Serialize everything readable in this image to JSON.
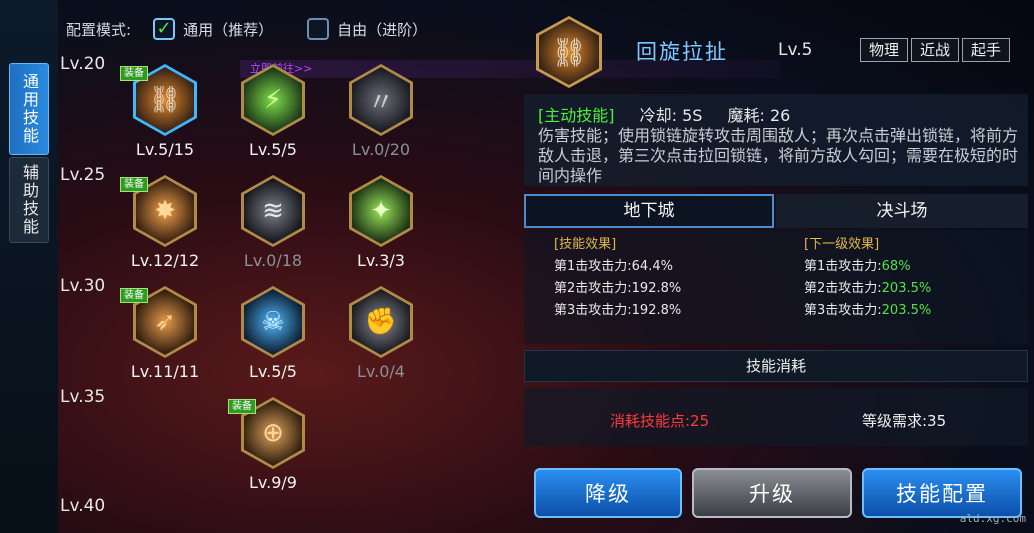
{
  "tabs": [
    {
      "label": "通用技能",
      "active": true
    },
    {
      "label": "辅助技能",
      "active": false
    }
  ],
  "mode": {
    "label": "配置模式:",
    "options": [
      {
        "label": "通用（推荐）",
        "checked": true
      },
      {
        "label": "自由（进阶）",
        "checked": false
      }
    ]
  },
  "go_link": "立即前往>>",
  "levels": [
    "Lv.20",
    "Lv.25",
    "Lv.30",
    "Lv.35",
    "Lv.40"
  ],
  "equip_badge": "装备",
  "skills": [
    {
      "level_text": "Lv.5/15",
      "equipped": true,
      "selected": true,
      "learned": true,
      "icon": "chain-spin-icon"
    },
    {
      "level_text": "Lv.5/5",
      "equipped": false,
      "selected": false,
      "learned": true,
      "icon": "green-slash-icon"
    },
    {
      "level_text": "Lv.0/20",
      "equipped": false,
      "selected": false,
      "learned": false,
      "icon": "claw-slash-icon"
    },
    {
      "level_text": "Lv.12/12",
      "equipped": true,
      "selected": false,
      "learned": true,
      "icon": "spark-burst-icon"
    },
    {
      "level_text": "Lv.0/18",
      "equipped": false,
      "selected": false,
      "learned": false,
      "icon": "wind-slash-icon"
    },
    {
      "level_text": "Lv.3/3",
      "equipped": false,
      "selected": false,
      "learned": true,
      "icon": "green-cannon-icon"
    },
    {
      "level_text": "Lv.11/11",
      "equipped": true,
      "selected": false,
      "learned": true,
      "icon": "fire-arrow-icon"
    },
    {
      "level_text": "Lv.5/5",
      "equipped": false,
      "selected": false,
      "learned": true,
      "icon": "skull-icon"
    },
    {
      "level_text": "Lv.0/4",
      "equipped": false,
      "selected": false,
      "learned": false,
      "icon": "fist-strike-icon"
    },
    {
      "level_text": "Lv.9/9",
      "equipped": true,
      "selected": false,
      "learned": true,
      "icon": "target-throw-icon"
    }
  ],
  "detail": {
    "name": "回旋拉扯",
    "level": "Lv.5",
    "tags": [
      "物理",
      "近战",
      "起手"
    ],
    "type_label": "[主动技能]",
    "cooldown": "冷却: 5S",
    "mana": "魔耗: 26",
    "description": "伤害技能；使用锁链旋转攻击周围敌人；再次点击弹出锁链，将前方敌人击退，第三次点击拉回锁链，将前方敌人勾回；需要在极短的时间内操作"
  },
  "mode_tabs": {
    "dungeon": "地下城",
    "arena": "决斗场"
  },
  "effects": {
    "current_title": "[技能效果]",
    "next_title": "[下一级效果]",
    "rows": [
      {
        "label": "第1击攻击力:",
        "current": "64.4%",
        "next": "68%"
      },
      {
        "label": "第2击攻击力:",
        "current": "192.8%",
        "next": "203.5%"
      },
      {
        "label": "第3击攻击力:",
        "current": "192.8%",
        "next": "203.5%"
      }
    ]
  },
  "cost": {
    "header": "技能消耗",
    "skill_points": "消耗技能点:25",
    "level_req": "等级需求:35"
  },
  "buttons": {
    "downgrade": "降级",
    "upgrade": "升级",
    "config": "技能配置"
  },
  "watermark": "ald.xg.com"
}
